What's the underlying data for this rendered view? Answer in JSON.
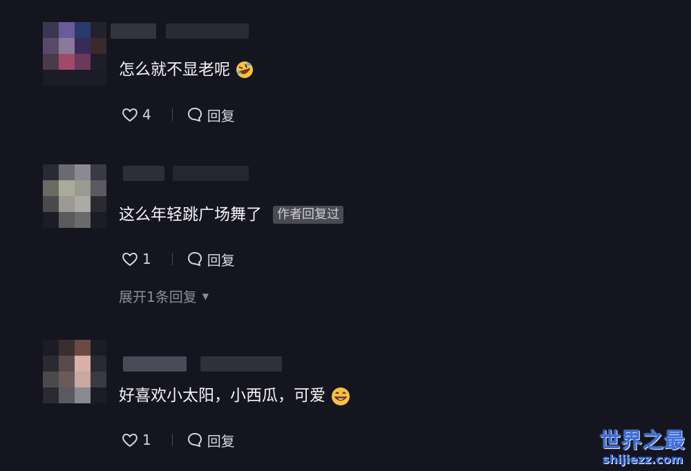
{
  "comments": [
    {
      "text": "怎么就不显老呢",
      "emoji": "rofl-emoji",
      "likes": "4",
      "reply_label": "回复"
    },
    {
      "text": "这么年轻跳广场舞了",
      "author_badge": "作者回复过",
      "likes": "1",
      "reply_label": "回复",
      "expand_label": "展开1条回复"
    },
    {
      "text": "好喜欢小太阳，小西瓜，可爱",
      "emoji": "grin-emoji",
      "likes": "1",
      "reply_label": "回复"
    }
  ],
  "icons": {
    "like": "heart-outline-icon",
    "reply": "speech-bubble-icon",
    "expand": "caret-down-icon"
  },
  "watermark": {
    "title": "世界之最",
    "url": "shijiezz.com"
  },
  "colors": {
    "background": "#151520",
    "text": "#f4f4f6",
    "muted": "#8e8e96",
    "badge_bg": "#4a4a52",
    "watermark": "#2f6be3"
  }
}
